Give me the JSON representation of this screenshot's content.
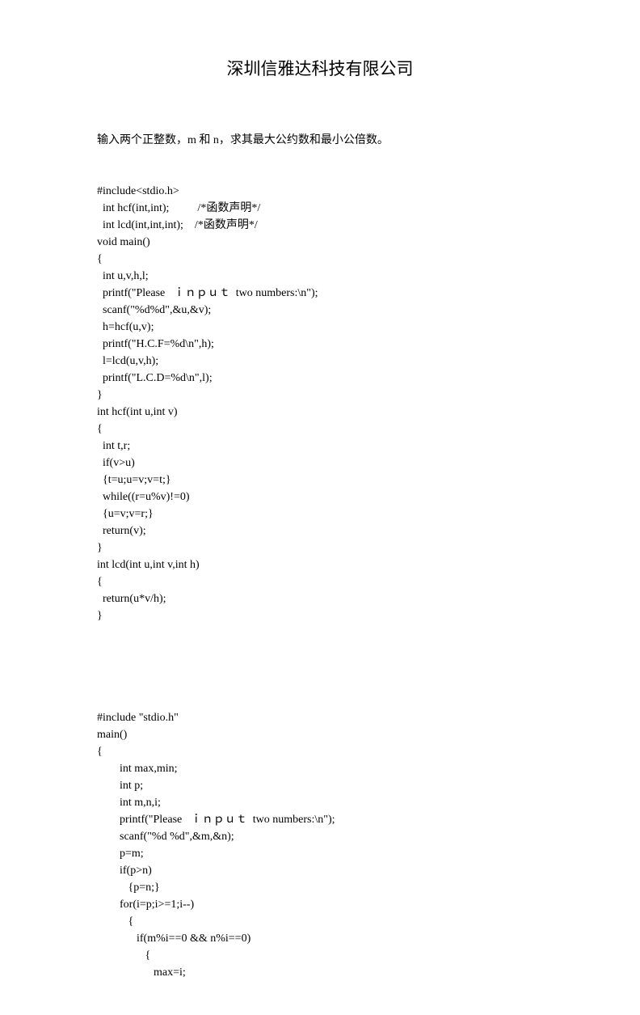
{
  "title": "深圳信雅达科技有限公司",
  "intro": "输入两个正整数，m 和 n，求其最大公约数和最小公倍数。",
  "code1": [
    "#include<stdio.h>",
    "  int hcf(int,int);          /*函数声明*/",
    "  int lcd(int,int,int);    /*函数声明*/",
    "void main()",
    "{",
    "  int u,v,h,l;",
    "  printf(\"Please   ｉｎｐｕｔ  two numbers:\\n\");",
    "  scanf(\"%d%d\",&u,&v);",
    "  h=hcf(u,v);",
    "  printf(\"H.C.F=%d\\n\",h);",
    "  l=lcd(u,v,h);",
    "  printf(\"L.C.D=%d\\n\",l);",
    "}",
    "int hcf(int u,int v)",
    "{",
    "  int t,r;",
    "  if(v>u)",
    "  {t=u;u=v;v=t;}",
    "  while((r=u%v)!=0)",
    "  {u=v;v=r;}",
    "  return(v);",
    "}",
    "int lcd(int u,int v,int h)",
    "{",
    "  return(u*v/h);",
    "}"
  ],
  "code2": [
    "#include \"stdio.h\"",
    "main()",
    "{",
    "        int max,min;",
    "        int p;",
    "        int m,n,i;",
    "        printf(\"Please   ｉｎｐｕｔ  two numbers:\\n\");",
    "        scanf(\"%d %d\",&m,&n);",
    "        p=m;",
    "        if(p>n)",
    "           {p=n;}",
    "        for(i=p;i>=1;i--)",
    "           {",
    "              if(m%i==0 && n%i==0)",
    "                 {",
    "                    max=i;"
  ]
}
